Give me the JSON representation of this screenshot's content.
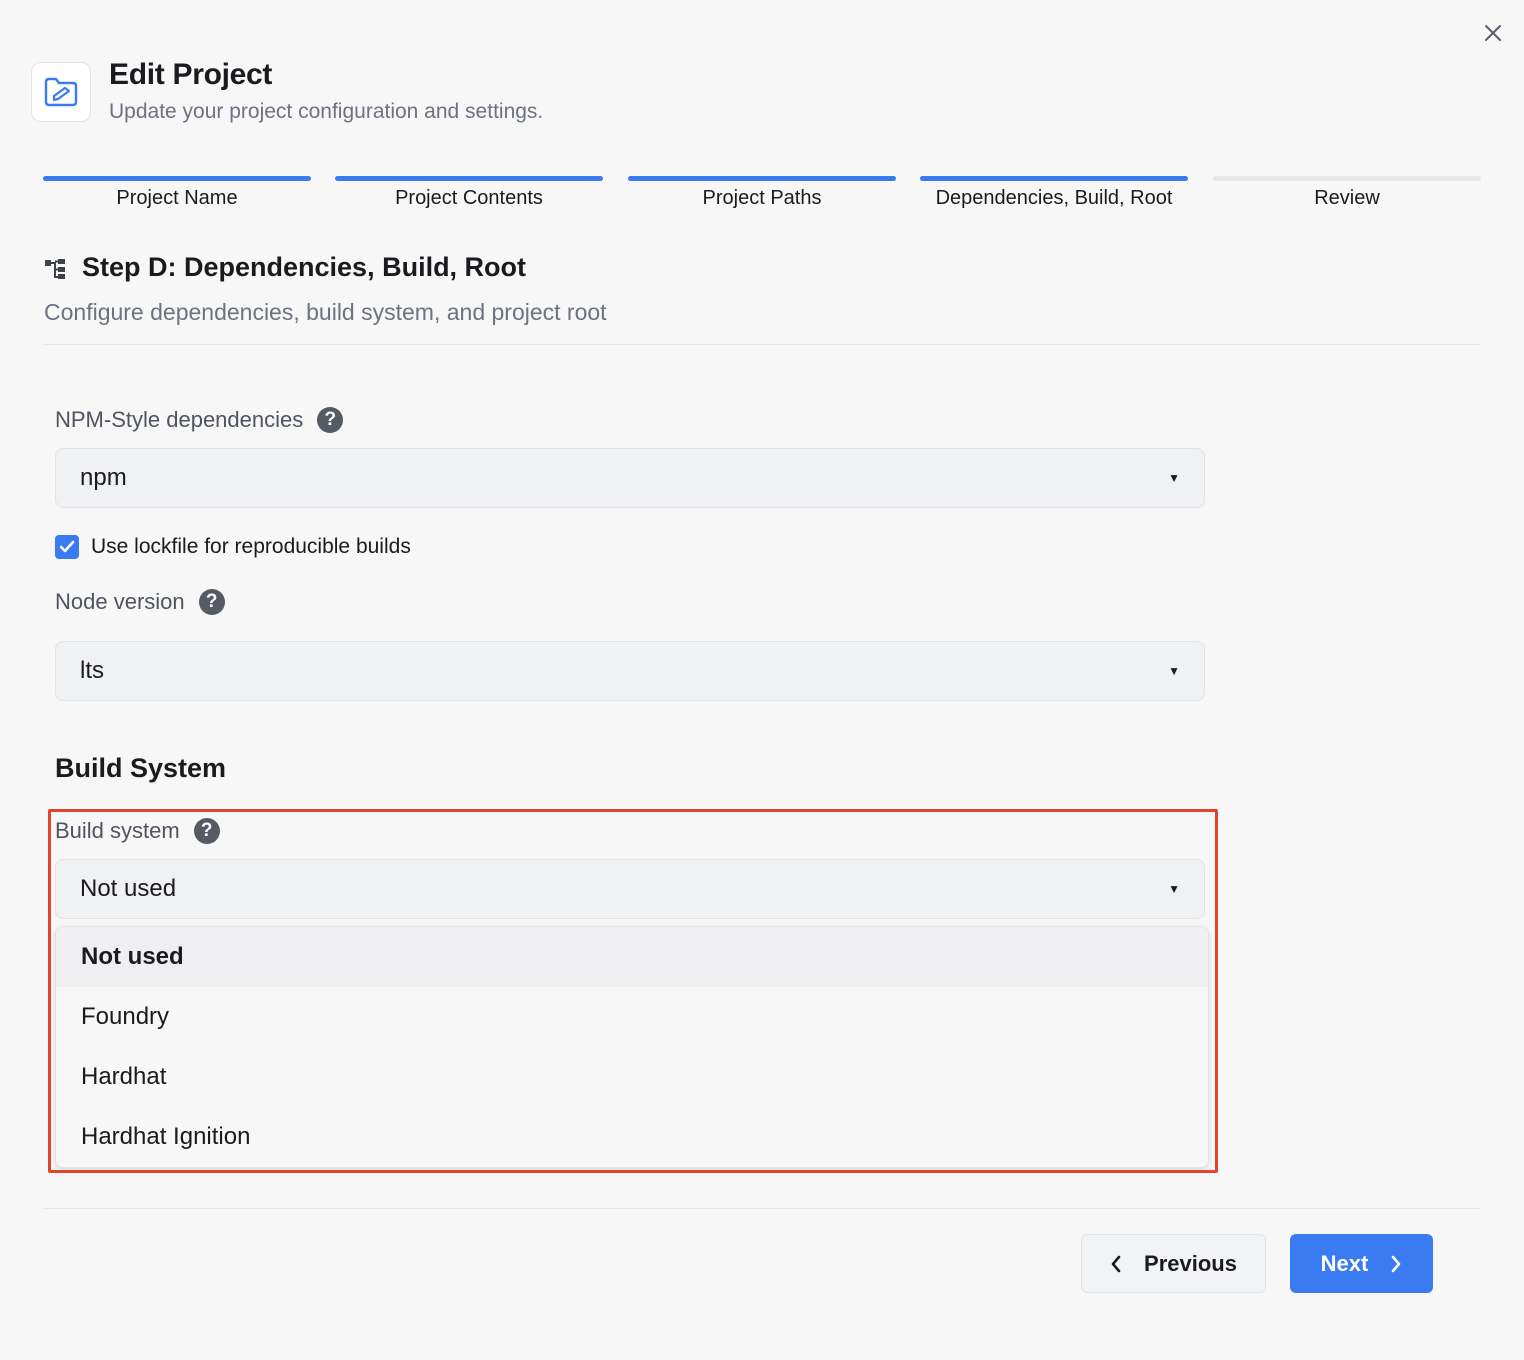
{
  "header": {
    "title": "Edit Project",
    "subtitle": "Update your project configuration and settings.",
    "icon": "folder-edit-icon"
  },
  "steps": [
    {
      "label": "Project Name",
      "state": "complete"
    },
    {
      "label": "Project Contents",
      "state": "complete"
    },
    {
      "label": "Project Paths",
      "state": "complete"
    },
    {
      "label": "Dependencies, Build, Root",
      "state": "current"
    },
    {
      "label": "Review",
      "state": "upcoming"
    }
  ],
  "section": {
    "title": "Step D: Dependencies, Build, Root",
    "subtitle": "Configure dependencies, build system, and project root"
  },
  "npm_deps": {
    "label": "NPM-Style dependencies",
    "value": "npm"
  },
  "lockfile": {
    "label": "Use lockfile for reproducible builds",
    "checked": true
  },
  "node_version": {
    "label": "Node version",
    "value": "lts"
  },
  "build": {
    "heading": "Build System",
    "label": "Build system",
    "value": "Not used",
    "options": [
      "Not used",
      "Foundry",
      "Hardhat",
      "Hardhat Ignition"
    ]
  },
  "footer": {
    "previous": "Previous",
    "next": "Next"
  },
  "colors": {
    "accent": "#3a7bf1",
    "highlight": "#e2452f"
  }
}
